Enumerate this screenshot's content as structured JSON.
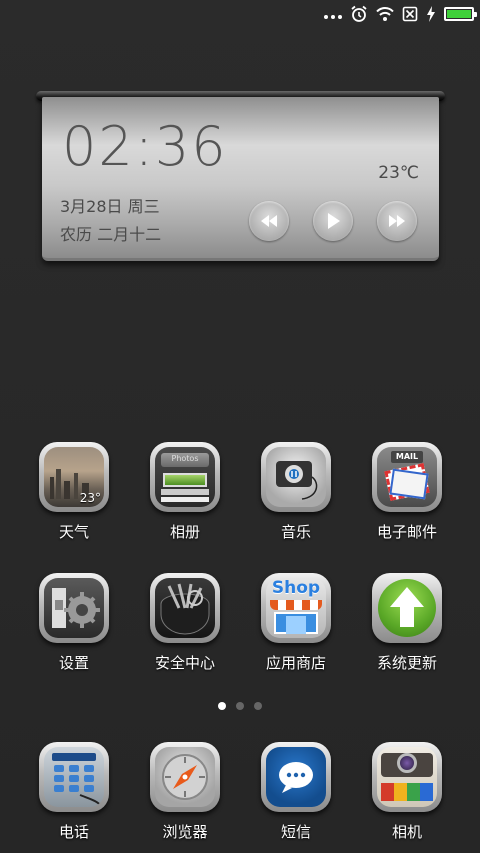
{
  "status_bar": {
    "icons": [
      "more-dots-icon",
      "alarm-icon",
      "wifi-icon",
      "no-sim-icon",
      "charging-icon",
      "battery-icon"
    ],
    "battery_level": 1.0,
    "battery_color": "#3fd13a"
  },
  "widget": {
    "time": "02:36",
    "date": "3月28日 周三",
    "lunar": "农历 二月十二",
    "temperature": "23℃",
    "controls": [
      "rewind-icon",
      "play-icon",
      "fast-forward-icon"
    ]
  },
  "apps_row1": [
    {
      "label": "天气",
      "icon": "weather-icon",
      "badge": "23°"
    },
    {
      "label": "相册",
      "icon": "gallery-icon",
      "badge": "Photos"
    },
    {
      "label": "音乐",
      "icon": "music-icon"
    },
    {
      "label": "电子邮件",
      "icon": "email-icon",
      "badge": "MAIL"
    }
  ],
  "apps_row2": [
    {
      "label": "设置",
      "icon": "settings-icon"
    },
    {
      "label": "安全中心",
      "icon": "security-center-icon"
    },
    {
      "label": "应用商店",
      "icon": "app-store-icon",
      "badge": "Shop"
    },
    {
      "label": "系统更新",
      "icon": "system-update-icon"
    }
  ],
  "pager": {
    "pages": 3,
    "current": 1
  },
  "dock": [
    {
      "label": "电话",
      "icon": "phone-icon"
    },
    {
      "label": "浏览器",
      "icon": "browser-icon"
    },
    {
      "label": "短信",
      "icon": "messages-icon"
    },
    {
      "label": "相机",
      "icon": "camera-icon"
    }
  ]
}
